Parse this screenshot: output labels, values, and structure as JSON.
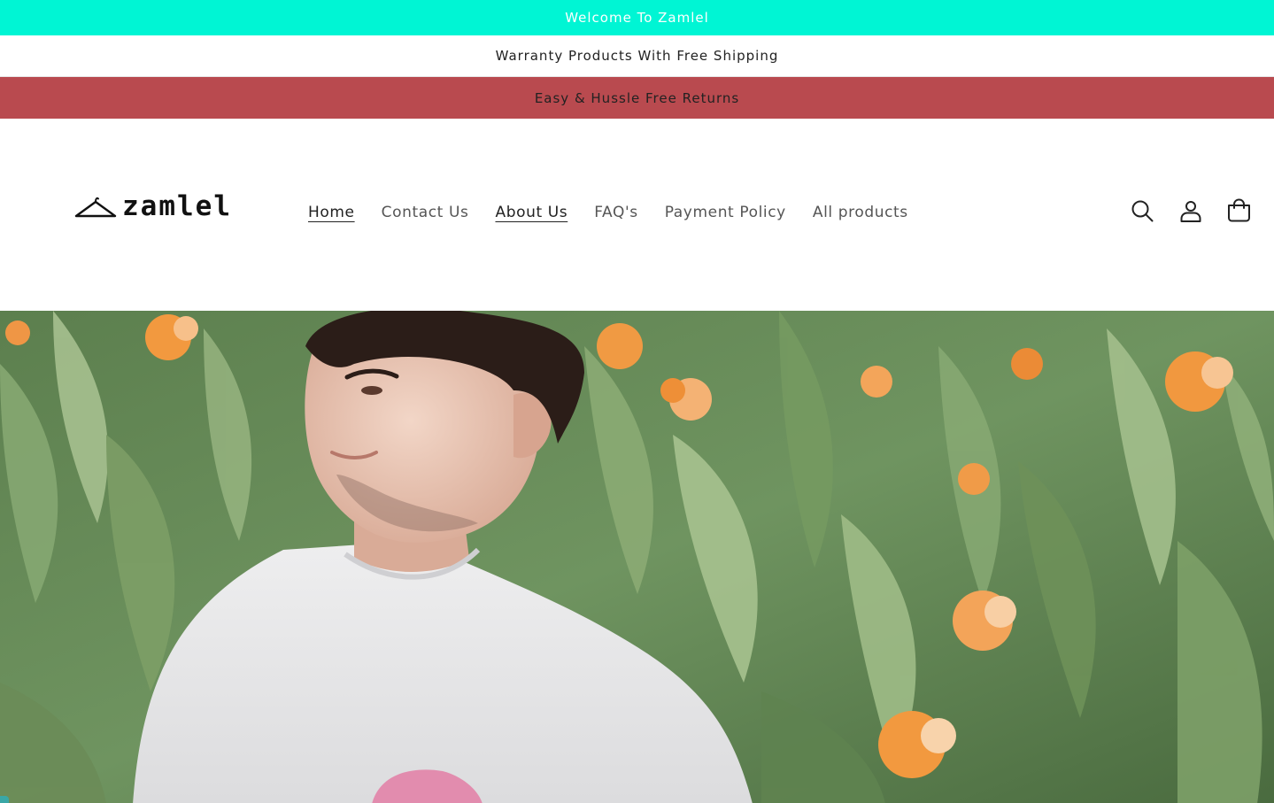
{
  "announcements": [
    {
      "text": "Welcome To Zamlel"
    },
    {
      "text": "Warranty Products With Free Shipping"
    },
    {
      "text": "Easy & Hussle Free Returns"
    }
  ],
  "header": {
    "logo_text": "zamlel",
    "nav": [
      {
        "label": "Home",
        "active": true
      },
      {
        "label": "Contact Us",
        "active": false
      },
      {
        "label": "About Us",
        "active": true
      },
      {
        "label": "FAQ's",
        "active": false
      },
      {
        "label": "Payment Policy",
        "active": false
      },
      {
        "label": "All products",
        "active": false
      }
    ],
    "icons": [
      "search-icon",
      "account-icon",
      "cart-icon"
    ]
  },
  "hero": {
    "image_subject": "man in white t-shirt standing in front of green leaves and orange canna flowers"
  },
  "colors": {
    "announcement_1_bg": "#00f5d4",
    "announcement_2_bg": "#ffffff",
    "announcement_3_bg": "#b94a4f"
  }
}
